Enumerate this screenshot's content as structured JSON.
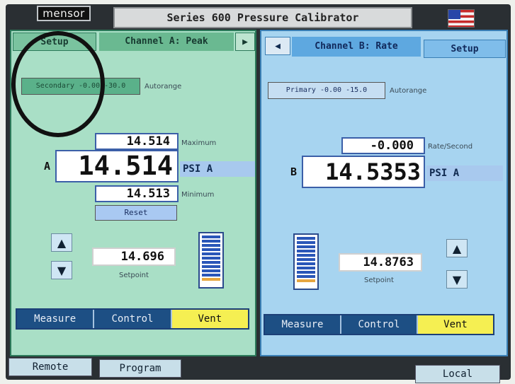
{
  "header": {
    "logo_text": "mensor",
    "title": "Series 600 Pressure Calibrator",
    "flag_icon": "us-flag-icon"
  },
  "channel_a": {
    "setup_label": "Setup",
    "title": "Channel A: Peak",
    "next_icon": "arrow-right-icon",
    "range_button": "Secondary -0.00 -30.0",
    "autorange_label": "Autorange",
    "max_value": "14.514",
    "max_label": "Maximum",
    "channel_letter": "A",
    "reading": "14.514",
    "unit": "PSI A",
    "min_value": "14.513",
    "min_label": "Minimum",
    "reset_label": "Reset",
    "setpoint_value": "14.696",
    "setpoint_label": "Setpoint",
    "modes": [
      "Measure",
      "Control",
      "Vent"
    ]
  },
  "channel_b": {
    "prev_icon": "arrow-left-icon",
    "title": "Channel B: Rate",
    "setup_label": "Setup",
    "range_button": "Primary -0.00 -15.0",
    "autorange_label": "Autorange",
    "rate_value": "-0.000",
    "rate_label": "Rate/Second",
    "channel_letter": "B",
    "reading": "14.5353",
    "unit": "PSI A",
    "setpoint_value": "14.8763",
    "setpoint_label": "Setpoint",
    "modes": [
      "Measure",
      "Control",
      "Vent"
    ]
  },
  "footer": {
    "remote_label": "Remote",
    "program_label": "Program",
    "local_label": "Local"
  },
  "colors": {
    "channel_a_bg": "#a9dfc6",
    "channel_b_bg": "#a7d4f0",
    "vent_active": "#f5ef52",
    "mode_button": "#1d4f84"
  }
}
